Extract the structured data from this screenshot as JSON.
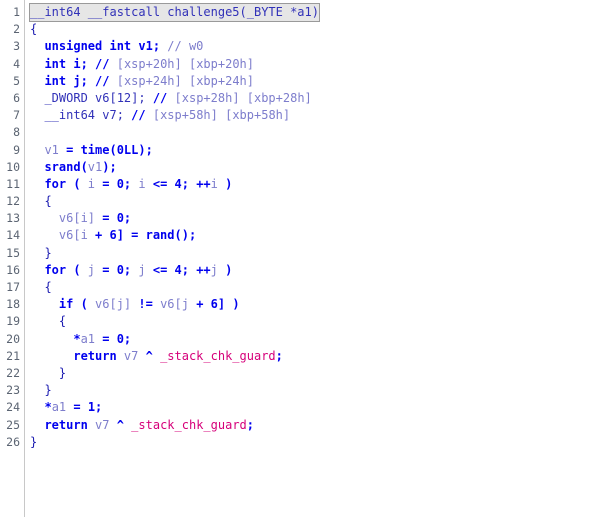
{
  "colors": {
    "keyword": "#0000ee",
    "variable": "#7d7dcc",
    "comment": "#7d7dcc",
    "plain": "#1a1ab0",
    "symbol": "#d6007a",
    "line_number": "#5b6472"
  },
  "lines": [
    {
      "num": "1",
      "tokens": [
        {
          "t": "__int64 __fastcall challenge5(_BYTE *a1)",
          "c": "tok-ident"
        }
      ]
    },
    {
      "num": "2",
      "tokens": [
        {
          "t": "{",
          "c": "tok-plain"
        }
      ]
    },
    {
      "num": "3",
      "tokens": [
        {
          "t": "  unsigned int v1; ",
          "c": "tok-keyword"
        },
        {
          "t": "// w0",
          "c": "tok-comment"
        }
      ]
    },
    {
      "num": "4",
      "tokens": [
        {
          "t": "  int i; ",
          "c": "tok-keyword"
        },
        {
          "t": "// ",
          "c": "tok-keyword"
        },
        {
          "t": "[xsp+20h] [xbp+20h]",
          "c": "tok-comment"
        }
      ]
    },
    {
      "num": "5",
      "tokens": [
        {
          "t": "  int j; ",
          "c": "tok-keyword"
        },
        {
          "t": "// ",
          "c": "tok-keyword"
        },
        {
          "t": "[xsp+24h] [xbp+24h]",
          "c": "tok-comment"
        }
      ]
    },
    {
      "num": "6",
      "tokens": [
        {
          "t": "  _DWORD v6[12]; ",
          "c": "tok-ident"
        },
        {
          "t": "// ",
          "c": "tok-keyword"
        },
        {
          "t": "[xsp+28h] [xbp+28h]",
          "c": "tok-comment"
        }
      ]
    },
    {
      "num": "7",
      "tokens": [
        {
          "t": "  __int64 v7; ",
          "c": "tok-ident"
        },
        {
          "t": "// ",
          "c": "tok-keyword"
        },
        {
          "t": "[xsp+58h] [xbp+58h]",
          "c": "tok-comment"
        }
      ]
    },
    {
      "num": "8",
      "tokens": [
        {
          "t": "",
          "c": "tok-plain"
        }
      ]
    },
    {
      "num": "9",
      "tokens": [
        {
          "t": "  ",
          "c": "tok-plain"
        },
        {
          "t": "v1",
          "c": "tok-var"
        },
        {
          "t": " = time(0LL);",
          "c": "tok-keyword"
        }
      ]
    },
    {
      "num": "10",
      "tokens": [
        {
          "t": "  srand(",
          "c": "tok-keyword"
        },
        {
          "t": "v1",
          "c": "tok-var"
        },
        {
          "t": ");",
          "c": "tok-keyword"
        }
      ]
    },
    {
      "num": "11",
      "tokens": [
        {
          "t": "  for ( ",
          "c": "tok-keyword"
        },
        {
          "t": "i",
          "c": "tok-var"
        },
        {
          "t": " = 0; ",
          "c": "tok-keyword"
        },
        {
          "t": "i",
          "c": "tok-var"
        },
        {
          "t": " <= 4; ++",
          "c": "tok-keyword"
        },
        {
          "t": "i",
          "c": "tok-var"
        },
        {
          "t": " )",
          "c": "tok-keyword"
        }
      ]
    },
    {
      "num": "12",
      "tokens": [
        {
          "t": "  {",
          "c": "tok-plain"
        }
      ]
    },
    {
      "num": "13",
      "tokens": [
        {
          "t": "    ",
          "c": "tok-plain"
        },
        {
          "t": "v6[i]",
          "c": "tok-var"
        },
        {
          "t": " = 0;",
          "c": "tok-keyword"
        }
      ]
    },
    {
      "num": "14",
      "tokens": [
        {
          "t": "    ",
          "c": "tok-plain"
        },
        {
          "t": "v6[i",
          "c": "tok-var"
        },
        {
          "t": " + 6] = rand();",
          "c": "tok-keyword"
        }
      ]
    },
    {
      "num": "15",
      "tokens": [
        {
          "t": "  }",
          "c": "tok-plain"
        }
      ]
    },
    {
      "num": "16",
      "tokens": [
        {
          "t": "  for ( ",
          "c": "tok-keyword"
        },
        {
          "t": "j",
          "c": "tok-var"
        },
        {
          "t": " = 0; ",
          "c": "tok-keyword"
        },
        {
          "t": "j",
          "c": "tok-var"
        },
        {
          "t": " <= 4; ++",
          "c": "tok-keyword"
        },
        {
          "t": "j",
          "c": "tok-var"
        },
        {
          "t": " )",
          "c": "tok-keyword"
        }
      ]
    },
    {
      "num": "17",
      "tokens": [
        {
          "t": "  {",
          "c": "tok-plain"
        }
      ]
    },
    {
      "num": "18",
      "tokens": [
        {
          "t": "    if ( ",
          "c": "tok-keyword"
        },
        {
          "t": "v6[j]",
          "c": "tok-var"
        },
        {
          "t": " != ",
          "c": "tok-keyword"
        },
        {
          "t": "v6[j",
          "c": "tok-var"
        },
        {
          "t": " + 6] )",
          "c": "tok-keyword"
        }
      ]
    },
    {
      "num": "19",
      "tokens": [
        {
          "t": "    {",
          "c": "tok-plain"
        }
      ]
    },
    {
      "num": "20",
      "tokens": [
        {
          "t": "      *",
          "c": "tok-keyword"
        },
        {
          "t": "a1",
          "c": "tok-var"
        },
        {
          "t": " = 0;",
          "c": "tok-keyword"
        }
      ]
    },
    {
      "num": "21",
      "tokens": [
        {
          "t": "      return ",
          "c": "tok-keyword"
        },
        {
          "t": "v7",
          "c": "tok-var"
        },
        {
          "t": " ^ ",
          "c": "tok-keyword"
        },
        {
          "t": "_stack_chk_guard",
          "c": "tok-symbol"
        },
        {
          "t": ";",
          "c": "tok-keyword"
        }
      ]
    },
    {
      "num": "22",
      "tokens": [
        {
          "t": "    }",
          "c": "tok-plain"
        }
      ]
    },
    {
      "num": "23",
      "tokens": [
        {
          "t": "  }",
          "c": "tok-plain"
        }
      ]
    },
    {
      "num": "24",
      "tokens": [
        {
          "t": "  *",
          "c": "tok-keyword"
        },
        {
          "t": "a1",
          "c": "tok-var"
        },
        {
          "t": " = 1;",
          "c": "tok-keyword"
        }
      ]
    },
    {
      "num": "25",
      "tokens": [
        {
          "t": "  return ",
          "c": "tok-keyword"
        },
        {
          "t": "v7",
          "c": "tok-var"
        },
        {
          "t": " ^ ",
          "c": "tok-keyword"
        },
        {
          "t": "_stack_chk_guard",
          "c": "tok-symbol"
        },
        {
          "t": ";",
          "c": "tok-keyword"
        }
      ]
    },
    {
      "num": "26",
      "tokens": [
        {
          "t": "}",
          "c": "tok-plain"
        }
      ]
    }
  ]
}
